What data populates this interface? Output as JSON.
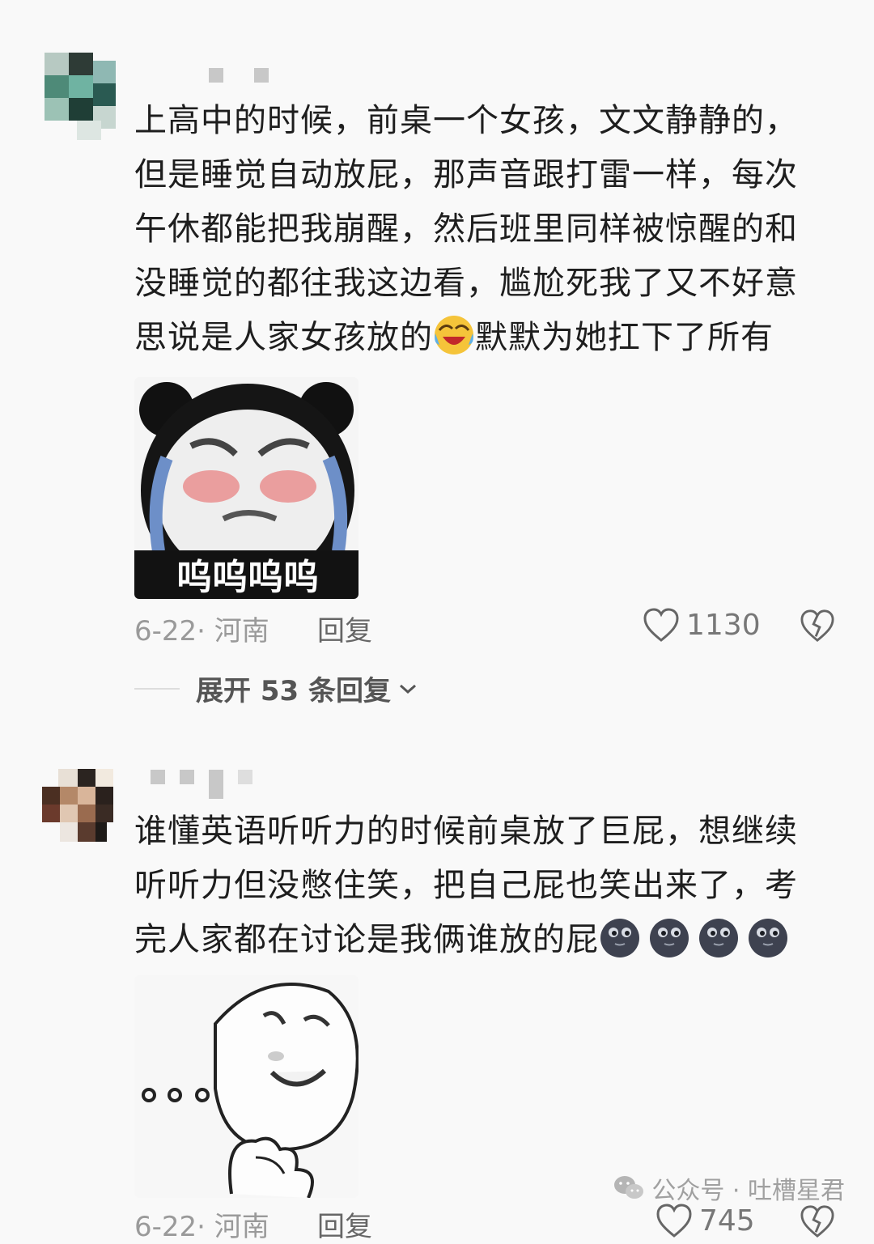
{
  "comments": [
    {
      "text_before_emoji": "上高中的时候，前桌一个女孩，文文静静的，但是睡觉自动放屁，那声音跟打雷一样，每次午休都能把我崩醒，然后班里同样被惊醒的和没睡觉的都往我这边看，尴尬死我了又不好意思说是人家女孩放的",
      "text_after_emoji": "默默为她扛下了所有",
      "emoji": "laughing-crying-emoji",
      "sticker_caption": "呜呜呜呜",
      "date_location": "6-22· 河南",
      "reply_label": "回复",
      "like_count": "1130",
      "expand_label": "展开 53 条回复"
    },
    {
      "text": "谁懂英语听听力的时候前桌放了巨屁，想继续听听力但没憋住笑，把自己屁也笑出来了，考完人家都在讨论是我俩谁放的屁",
      "emoji": "dark-face-emoji",
      "emoji_count": 4,
      "sticker": "thinking-face-sticker",
      "date_location": "6-22· 河南",
      "reply_label": "回复",
      "like_count": "745"
    }
  ],
  "watermark": {
    "icon": "wechat-icon",
    "label": "公众号 · 吐槽星君"
  }
}
